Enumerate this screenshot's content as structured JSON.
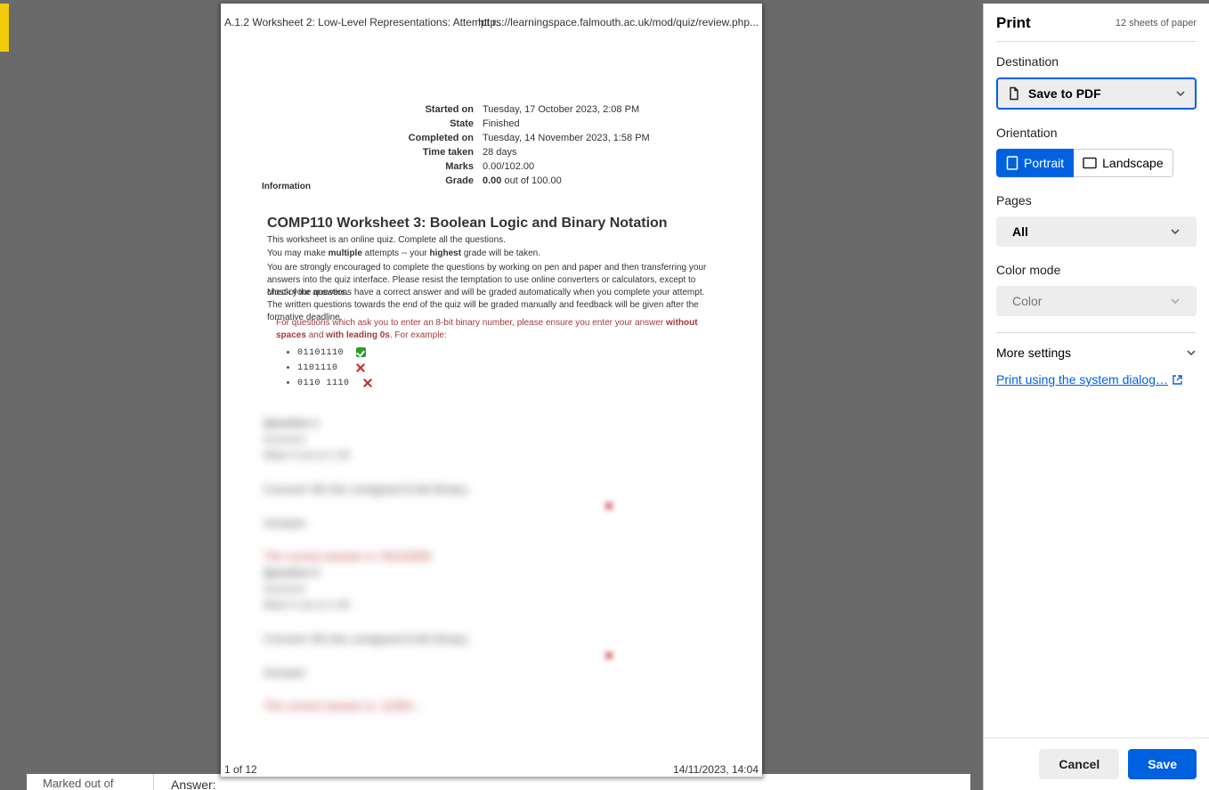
{
  "preview": {
    "header_left": "A.1.2 Worksheet 2: Low-Level Representations: Attempt r...",
    "header_right": "https://learningspace.falmouth.ac.uk/mod/quiz/review.php...",
    "summary": {
      "started_on_label": "Started on",
      "started_on": "Tuesday, 17 October 2023, 2:08 PM",
      "state_label": "State",
      "state": "Finished",
      "completed_on_label": "Completed on",
      "completed_on": "Tuesday, 14 November 2023, 1:58 PM",
      "time_taken_label": "Time taken",
      "time_taken": "28 days",
      "marks_label": "Marks",
      "marks": "0.00/102.00",
      "grade_label": "Grade",
      "grade_strong": "0.00",
      "grade_rest": " out of 100.00"
    },
    "info_label": "Information",
    "title": "COMP110 Worksheet 3: Boolean Logic and Binary Notation",
    "p1": "This worksheet is an online quiz. Complete all the questions.",
    "p2_a": "You may make ",
    "p2_b": "multiple",
    "p2_c": " attempts -- your ",
    "p2_d": "highest",
    "p2_e": " grade will be taken.",
    "p3": "You are strongly encouraged to complete the questions by working on pen and paper and then transferring your answers into the quiz interface. Please resist the temptation to use online converters or calculators, except to check your answers.",
    "p4": "Most of the questions have a correct answer and will be graded automatically when you complete your attempt. The written questions towards the end of the quiz will be graded manually and feedback will be given after the formative deadline.",
    "red_a": "For questions which ask you to enter an 8-bit binary number, please ensure you enter your answer ",
    "red_b": "without spaces",
    "red_c": " and ",
    "red_d": "with leading 0s",
    "red_e": ". For example:",
    "examples": [
      "01101110",
      "1101110",
      "0110 1110"
    ],
    "footer_left": "1 of 12",
    "footer_right": "14/11/2023, 14:04"
  },
  "blur": {
    "q_title": "Question 1",
    "q_sub1": "Incorrect",
    "q_sub2": "Mark 0 out of 1.00",
    "q_prompt": "Convert 48 into unsigned 8-bit binary.",
    "q_ans_label": "Answer:",
    "q_wrong": "The correct answer is: 00110000",
    "q2_title": "Question 2",
    "q2_prompt": "Convert 48 into unsigned 8-bit binary.",
    "q2_wrong": "The correct answer is: 11000..."
  },
  "bg": {
    "marked_out": "Marked out of",
    "answer": "Answer:"
  },
  "panel": {
    "title": "Print",
    "sheet_count": "12 sheets of paper",
    "destination_label": "Destination",
    "destination_value": "Save to PDF",
    "orientation_label": "Orientation",
    "portrait": "Portrait",
    "landscape": "Landscape",
    "pages_label": "Pages",
    "pages_value": "All",
    "color_label": "Color mode",
    "color_value": "Color",
    "more_settings": "More settings",
    "system_dialog": "Print using the system dialog…",
    "cancel": "Cancel",
    "save": "Save"
  }
}
